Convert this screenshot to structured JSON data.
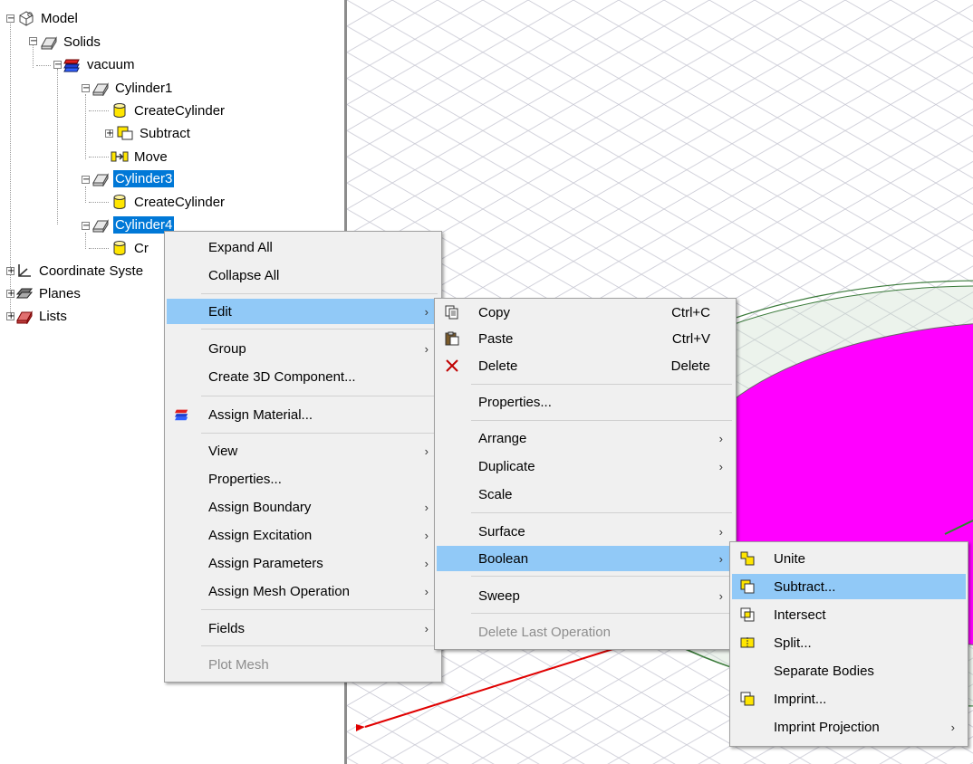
{
  "tree": {
    "model": "Model",
    "solids": "Solids",
    "vacuum": "vacuum",
    "cylinder1": "Cylinder1",
    "create_cylinder": "CreateCylinder",
    "subtract": "Subtract",
    "move": "Move",
    "cylinder3": "Cylinder3",
    "cylinder4": "Cylinder4",
    "create_cylinder_partial": "Cr",
    "coordinate_systems": "Coordinate Syste",
    "planes": "Planes",
    "lists": "Lists"
  },
  "context_menu": {
    "expand_all": "Expand All",
    "collapse_all": "Collapse All",
    "edit": "Edit",
    "group": "Group",
    "create_3d_component": "Create 3D Component...",
    "assign_material": "Assign Material...",
    "view": "View",
    "properties": "Properties...",
    "assign_boundary": "Assign Boundary",
    "assign_excitation": "Assign Excitation",
    "assign_parameters": "Assign Parameters",
    "assign_mesh_operation": "Assign Mesh Operation",
    "fields": "Fields",
    "plot_mesh": "Plot Mesh"
  },
  "edit_menu": {
    "copy": "Copy",
    "copy_shortcut": "Ctrl+C",
    "paste": "Paste",
    "paste_shortcut": "Ctrl+V",
    "delete": "Delete",
    "delete_shortcut": "Delete",
    "properties": "Properties...",
    "arrange": "Arrange",
    "duplicate": "Duplicate",
    "scale": "Scale",
    "surface": "Surface",
    "boolean": "Boolean",
    "sweep": "Sweep",
    "delete_last_operation": "Delete Last Operation"
  },
  "boolean_menu": {
    "unite": "Unite",
    "subtract": "Subtract...",
    "intersect": "Intersect",
    "split": "Split...",
    "separate_bodies": "Separate Bodies",
    "imprint": "Imprint...",
    "imprint_projection": "Imprint Projection"
  },
  "colors": {
    "selection": "#0078d7",
    "menu_highlight": "#91c9f7",
    "object_fill": "#ff00ff",
    "axis": "#e00000"
  }
}
